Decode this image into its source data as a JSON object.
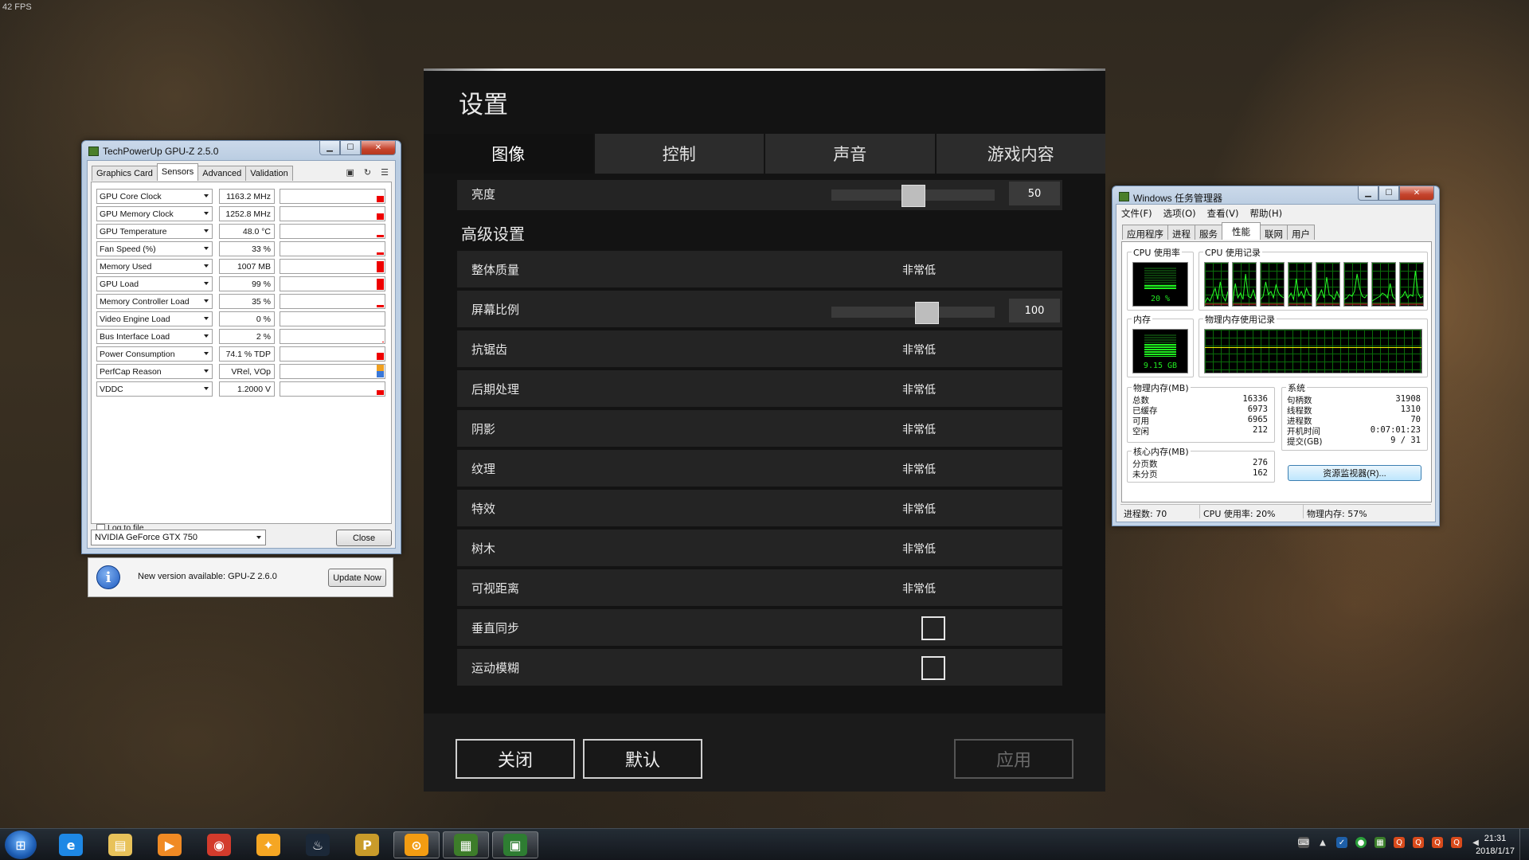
{
  "overlay": {
    "fps": "42 FPS"
  },
  "settings": {
    "title": "设置",
    "tabs": [
      "图像",
      "控制",
      "声音",
      "游戏内容"
    ],
    "brightness": {
      "label": "亮度",
      "value": "50",
      "level": 0.5
    },
    "section_title": "高级设置",
    "overall_quality": {
      "label": "整体质量",
      "value": "非常低"
    },
    "screen_scale": {
      "label": "屏幕比例",
      "value": "100",
      "level": 0.6
    },
    "options": [
      {
        "label": "抗锯齿",
        "value": "非常低"
      },
      {
        "label": "后期处理",
        "value": "非常低"
      },
      {
        "label": "阴影",
        "value": "非常低"
      },
      {
        "label": "纹理",
        "value": "非常低"
      },
      {
        "label": "特效",
        "value": "非常低"
      },
      {
        "label": "树木",
        "value": "非常低"
      },
      {
        "label": "可视距离",
        "value": "非常低"
      }
    ],
    "vsync": {
      "label": "垂直同步",
      "checked": false
    },
    "motion_blur": {
      "label": "运动模糊",
      "checked": false
    },
    "buttons": {
      "close": "关闭",
      "default": "默认",
      "apply": "应用"
    }
  },
  "gpuz": {
    "title": "TechPowerUp GPU-Z 2.5.0",
    "tabs": [
      "Graphics Card",
      "Sensors",
      "Advanced",
      "Validation"
    ],
    "active_tab": "Sensors",
    "sensors": [
      {
        "name": "GPU Core Clock",
        "value": "1163.2 MHz",
        "level": 0.45
      },
      {
        "name": "GPU Memory Clock",
        "value": "1252.8 MHz",
        "level": 0.45
      },
      {
        "name": "GPU Temperature",
        "value": "48.0 °C",
        "level": 0.2
      },
      {
        "name": "Fan Speed (%)",
        "value": "33 %",
        "level": 0.2
      },
      {
        "name": "Memory Used",
        "value": "1007 MB",
        "level": 0.8
      },
      {
        "name": "GPU Load",
        "value": "99 %",
        "level": 0.85
      },
      {
        "name": "Memory Controller Load",
        "value": "35 %",
        "level": 0.2
      },
      {
        "name": "Video Engine Load",
        "value": "0 %",
        "level": 0
      },
      {
        "name": "Bus Interface Load",
        "value": "2 %",
        "level": 0.08
      },
      {
        "name": "Power Consumption",
        "value": "74.1 % TDP",
        "level": 0.55
      },
      {
        "name": "PerfCap Reason",
        "value": "VRel, VOp",
        "level": 0.85,
        "style": "perfcap"
      },
      {
        "name": "VDDC",
        "value": "1.2000 V",
        "level": 0.35
      }
    ],
    "log_to_file": "Log to file",
    "gpu_select": "NVIDIA GeForce GTX 750",
    "close_label": "Close",
    "update_text": "New version available: GPU-Z 2.6.0",
    "update_button": "Update Now"
  },
  "taskmgr": {
    "title": "Windows 任务管理器",
    "menu": [
      "文件(F)",
      "选项(O)",
      "查看(V)",
      "帮助(H)"
    ],
    "tabs": [
      "应用程序",
      "进程",
      "服务",
      "性能",
      "联网",
      "用户"
    ],
    "active_tab": "性能",
    "cpu_usage_label": "CPU 使用率",
    "cpu_usage_value": "20 %",
    "cpu_level": 0.2,
    "cpu_history_label": "CPU 使用记录",
    "memory_label": "内存",
    "memory_value": "9.15 GB",
    "memory_level": 0.57,
    "memory_history_label": "物理内存使用记录",
    "physical_memory": {
      "label": "物理内存(MB)",
      "rows": [
        {
          "k": "总数",
          "v": "16336"
        },
        {
          "k": "已缓存",
          "v": "6973"
        },
        {
          "k": "可用",
          "v": "6965"
        },
        {
          "k": "空闲",
          "v": "212"
        }
      ]
    },
    "kernel_memory": {
      "label": "核心内存(MB)",
      "rows": [
        {
          "k": "分页数",
          "v": "276"
        },
        {
          "k": "未分页",
          "v": "162"
        }
      ]
    },
    "system": {
      "label": "系统",
      "rows": [
        {
          "k": "句柄数",
          "v": "31908"
        },
        {
          "k": "线程数",
          "v": "1310"
        },
        {
          "k": "进程数",
          "v": "70"
        },
        {
          "k": "开机时间",
          "v": "0:07:01:23"
        },
        {
          "k": "提交(GB)",
          "v": "9 / 31"
        }
      ]
    },
    "resource_monitor_button": "资源监视器(R)...",
    "status": {
      "processes": "进程数: 70",
      "cpu": "CPU 使用率: 20%",
      "memory": "物理内存: 57%"
    }
  },
  "taskbar": {
    "clock_time": "21:31",
    "clock_date": "2018/1/17",
    "apps": [
      {
        "name": "internet-explorer",
        "glyph": "e",
        "color": "#1e88e5"
      },
      {
        "name": "file-explorer",
        "glyph": "▤",
        "color": "#e8c25a"
      },
      {
        "name": "media-player",
        "glyph": "▶",
        "color": "#f08a24"
      },
      {
        "name": "chrome",
        "glyph": "◉",
        "color": "#d33b2c"
      },
      {
        "name": "app-store",
        "glyph": "✦",
        "color": "#f5a623"
      },
      {
        "name": "steam",
        "glyph": "♨",
        "color": "#1b2838"
      },
      {
        "name": "pubg",
        "glyph": "P",
        "color": "#c99b2a"
      },
      {
        "name": "overwatch",
        "glyph": "⊙",
        "color": "#f39c12"
      },
      {
        "name": "gpu-z",
        "glyph": "▦",
        "color": "#3d7d2a"
      },
      {
        "name": "task-manager",
        "glyph": "▣",
        "color": "#2e7d32"
      }
    ]
  }
}
